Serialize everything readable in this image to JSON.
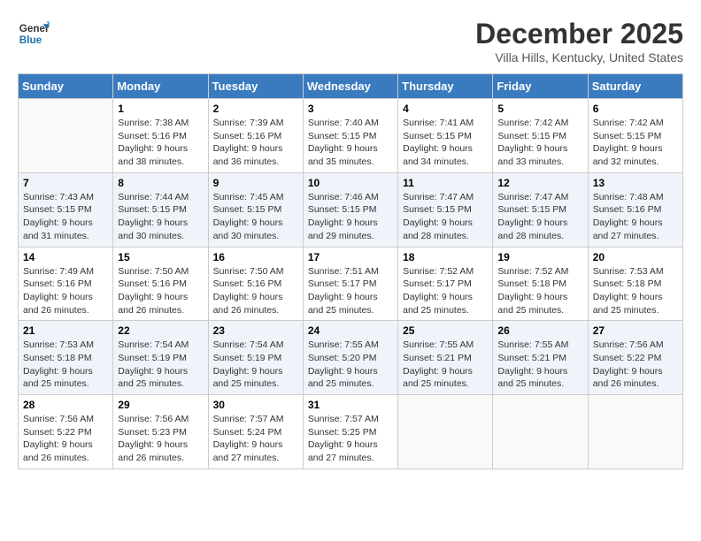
{
  "header": {
    "logo_general": "General",
    "logo_blue": "Blue",
    "month": "December 2025",
    "location": "Villa Hills, Kentucky, United States"
  },
  "days_of_week": [
    "Sunday",
    "Monday",
    "Tuesday",
    "Wednesday",
    "Thursday",
    "Friday",
    "Saturday"
  ],
  "weeks": [
    [
      {
        "day": "",
        "info": ""
      },
      {
        "day": "1",
        "info": "Sunrise: 7:38 AM\nSunset: 5:16 PM\nDaylight: 9 hours\nand 38 minutes."
      },
      {
        "day": "2",
        "info": "Sunrise: 7:39 AM\nSunset: 5:16 PM\nDaylight: 9 hours\nand 36 minutes."
      },
      {
        "day": "3",
        "info": "Sunrise: 7:40 AM\nSunset: 5:15 PM\nDaylight: 9 hours\nand 35 minutes."
      },
      {
        "day": "4",
        "info": "Sunrise: 7:41 AM\nSunset: 5:15 PM\nDaylight: 9 hours\nand 34 minutes."
      },
      {
        "day": "5",
        "info": "Sunrise: 7:42 AM\nSunset: 5:15 PM\nDaylight: 9 hours\nand 33 minutes."
      },
      {
        "day": "6",
        "info": "Sunrise: 7:42 AM\nSunset: 5:15 PM\nDaylight: 9 hours\nand 32 minutes."
      }
    ],
    [
      {
        "day": "7",
        "info": "Sunrise: 7:43 AM\nSunset: 5:15 PM\nDaylight: 9 hours\nand 31 minutes."
      },
      {
        "day": "8",
        "info": "Sunrise: 7:44 AM\nSunset: 5:15 PM\nDaylight: 9 hours\nand 30 minutes."
      },
      {
        "day": "9",
        "info": "Sunrise: 7:45 AM\nSunset: 5:15 PM\nDaylight: 9 hours\nand 30 minutes."
      },
      {
        "day": "10",
        "info": "Sunrise: 7:46 AM\nSunset: 5:15 PM\nDaylight: 9 hours\nand 29 minutes."
      },
      {
        "day": "11",
        "info": "Sunrise: 7:47 AM\nSunset: 5:15 PM\nDaylight: 9 hours\nand 28 minutes."
      },
      {
        "day": "12",
        "info": "Sunrise: 7:47 AM\nSunset: 5:15 PM\nDaylight: 9 hours\nand 28 minutes."
      },
      {
        "day": "13",
        "info": "Sunrise: 7:48 AM\nSunset: 5:16 PM\nDaylight: 9 hours\nand 27 minutes."
      }
    ],
    [
      {
        "day": "14",
        "info": "Sunrise: 7:49 AM\nSunset: 5:16 PM\nDaylight: 9 hours\nand 26 minutes."
      },
      {
        "day": "15",
        "info": "Sunrise: 7:50 AM\nSunset: 5:16 PM\nDaylight: 9 hours\nand 26 minutes."
      },
      {
        "day": "16",
        "info": "Sunrise: 7:50 AM\nSunset: 5:16 PM\nDaylight: 9 hours\nand 26 minutes."
      },
      {
        "day": "17",
        "info": "Sunrise: 7:51 AM\nSunset: 5:17 PM\nDaylight: 9 hours\nand 25 minutes."
      },
      {
        "day": "18",
        "info": "Sunrise: 7:52 AM\nSunset: 5:17 PM\nDaylight: 9 hours\nand 25 minutes."
      },
      {
        "day": "19",
        "info": "Sunrise: 7:52 AM\nSunset: 5:18 PM\nDaylight: 9 hours\nand 25 minutes."
      },
      {
        "day": "20",
        "info": "Sunrise: 7:53 AM\nSunset: 5:18 PM\nDaylight: 9 hours\nand 25 minutes."
      }
    ],
    [
      {
        "day": "21",
        "info": "Sunrise: 7:53 AM\nSunset: 5:18 PM\nDaylight: 9 hours\nand 25 minutes."
      },
      {
        "day": "22",
        "info": "Sunrise: 7:54 AM\nSunset: 5:19 PM\nDaylight: 9 hours\nand 25 minutes."
      },
      {
        "day": "23",
        "info": "Sunrise: 7:54 AM\nSunset: 5:19 PM\nDaylight: 9 hours\nand 25 minutes."
      },
      {
        "day": "24",
        "info": "Sunrise: 7:55 AM\nSunset: 5:20 PM\nDaylight: 9 hours\nand 25 minutes."
      },
      {
        "day": "25",
        "info": "Sunrise: 7:55 AM\nSunset: 5:21 PM\nDaylight: 9 hours\nand 25 minutes."
      },
      {
        "day": "26",
        "info": "Sunrise: 7:55 AM\nSunset: 5:21 PM\nDaylight: 9 hours\nand 25 minutes."
      },
      {
        "day": "27",
        "info": "Sunrise: 7:56 AM\nSunset: 5:22 PM\nDaylight: 9 hours\nand 26 minutes."
      }
    ],
    [
      {
        "day": "28",
        "info": "Sunrise: 7:56 AM\nSunset: 5:22 PM\nDaylight: 9 hours\nand 26 minutes."
      },
      {
        "day": "29",
        "info": "Sunrise: 7:56 AM\nSunset: 5:23 PM\nDaylight: 9 hours\nand 26 minutes."
      },
      {
        "day": "30",
        "info": "Sunrise: 7:57 AM\nSunset: 5:24 PM\nDaylight: 9 hours\nand 27 minutes."
      },
      {
        "day": "31",
        "info": "Sunrise: 7:57 AM\nSunset: 5:25 PM\nDaylight: 9 hours\nand 27 minutes."
      },
      {
        "day": "",
        "info": ""
      },
      {
        "day": "",
        "info": ""
      },
      {
        "day": "",
        "info": ""
      }
    ]
  ]
}
